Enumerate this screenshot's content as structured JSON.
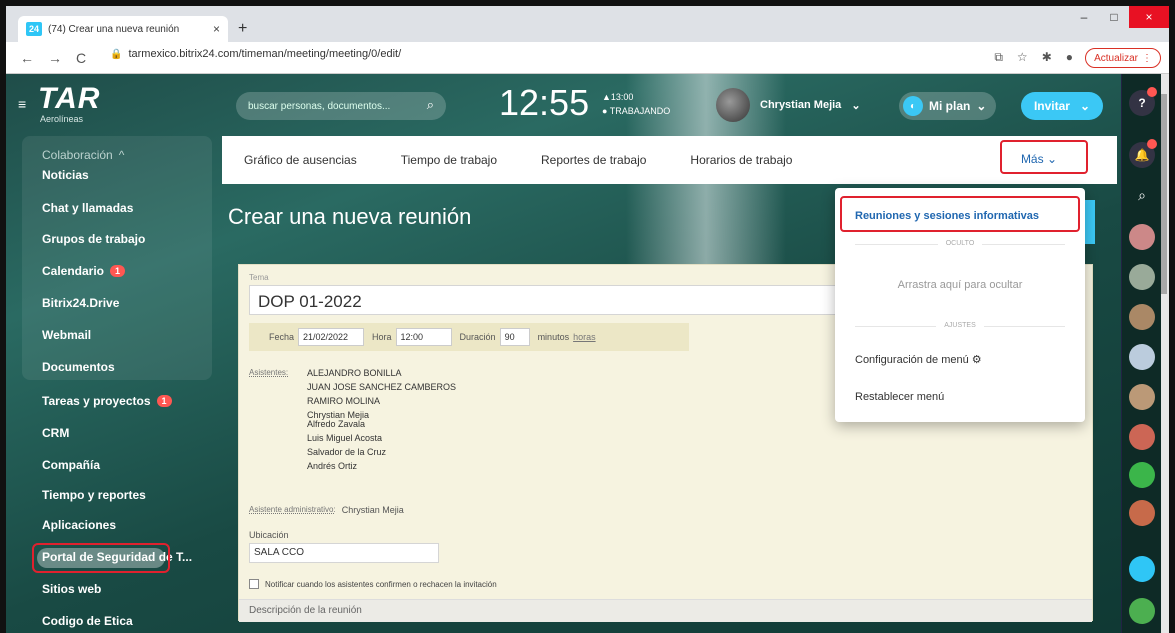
{
  "browser": {
    "tab_badge": "24",
    "tab_title": "(74) Crear una nueva reunión",
    "tab_close": "×",
    "new_tab": "+",
    "url": "tarmexico.bitrix24.com/timeman/meeting/meeting/0/edit/",
    "update_label": "Actualizar",
    "win_min": "–",
    "win_max": "□",
    "win_close": "×"
  },
  "header": {
    "logo_big": "TAR",
    "logo_small": "Aerolíneas",
    "search_placeholder": "buscar personas, documentos...",
    "clock": "12:55",
    "work_time": "▲13:00",
    "work_status": "● TRABAJANDO",
    "user_name": "Chrystian Mejia",
    "plan_label": "Mi plan",
    "invite_label": "Invitar"
  },
  "sidebar": {
    "group_label": "Colaboración",
    "items": [
      {
        "label": "Noticias"
      },
      {
        "label": "Chat y llamadas"
      },
      {
        "label": "Grupos de trabajo"
      },
      {
        "label": "Calendario",
        "badge": "1"
      },
      {
        "label": "Bitrix24.Drive"
      },
      {
        "label": "Webmail"
      },
      {
        "label": "Documentos"
      },
      {
        "label": "Tareas y proyectos",
        "badge": "1"
      },
      {
        "label": "CRM"
      },
      {
        "label": "Compañía"
      },
      {
        "label": "Tiempo y reportes"
      },
      {
        "label": "Aplicaciones"
      },
      {
        "label": "Portal de Seguridad de T..."
      },
      {
        "label": "Sitios web"
      },
      {
        "label": "Codigo de Etica"
      }
    ]
  },
  "topnav": {
    "items": [
      "Gráfico de ausencias",
      "Tiempo de trabajo",
      "Reportes de trabajo",
      "Horarios de trabajo"
    ],
    "more": "Más ⌄"
  },
  "page": {
    "title": "Crear una nueva reunión"
  },
  "form": {
    "topic_label": "Tema",
    "topic": "DOP 01-2022",
    "date_label": "Fecha",
    "date": "21/02/2022",
    "time_label": "Hora",
    "time": "12:00",
    "duration_label": "Duración",
    "duration": "90",
    "unit_minutes": "minutos",
    "unit_hours": "horas",
    "attendees_label": "Asistentes:",
    "attendees": [
      "ALEJANDRO BONILLA",
      "JUAN JOSE SANCHEZ CAMBEROS",
      "RAMIRO MOLINA",
      "Chrystian Mejia",
      "Alfredo Zavala",
      "Luis Miguel Acosta",
      "Salvador de la Cruz",
      "Andrés Ortiz"
    ],
    "admin_label": "Asistente administrativo:",
    "admin_name": "Chrystian Mejia",
    "location_label": "Ubicación",
    "location": "SALA CCO",
    "notify_label": "Notificar cuando los asistentes confirmen o rechacen la invitación",
    "description_label": "Descripción de la reunión"
  },
  "dropdown": {
    "first_item": "Reuniones y sesiones informativas",
    "hidden_section": "OCULTO",
    "drag_placeholder": "Arrastra aquí para ocultar",
    "settings_section": "AJUSTES",
    "config_item": "Configuración de menú ⚙",
    "reset_item": "Restablecer menú"
  },
  "colors": {
    "accent": "#3bc8f5",
    "highlight": "#e0212e",
    "link": "#2067b0"
  }
}
